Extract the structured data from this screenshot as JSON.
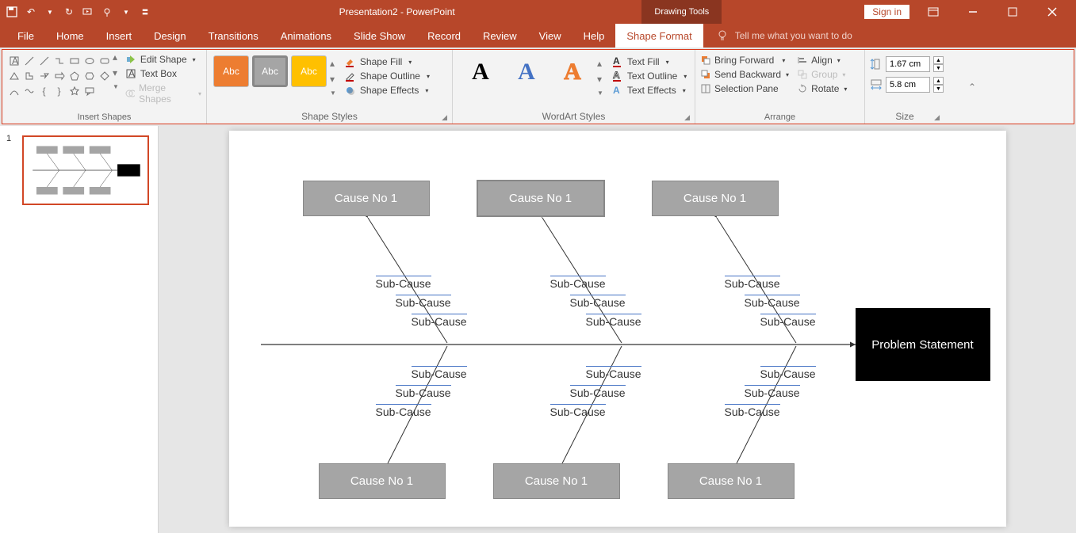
{
  "title": "Presentation2 - PowerPoint",
  "contextual_tab": "Drawing Tools",
  "signin": "Sign in",
  "menu": {
    "file": "File",
    "home": "Home",
    "insert": "Insert",
    "design": "Design",
    "transitions": "Transitions",
    "animations": "Animations",
    "slideshow": "Slide Show",
    "record": "Record",
    "review": "Review",
    "view": "View",
    "help": "Help",
    "shapeformat": "Shape Format",
    "tellme": "Tell me what you want to do"
  },
  "ribbon": {
    "insert_shapes": {
      "label": "Insert Shapes",
      "edit_shape": "Edit Shape",
      "text_box": "Text Box",
      "merge_shapes": "Merge Shapes"
    },
    "shape_styles": {
      "label": "Shape Styles",
      "swatch": "Abc",
      "fill": "Shape Fill",
      "outline": "Shape Outline",
      "effects": "Shape Effects"
    },
    "wordart": {
      "label": "WordArt Styles",
      "text_fill": "Text Fill",
      "text_outline": "Text Outline",
      "text_effects": "Text Effects"
    },
    "arrange": {
      "label": "Arrange",
      "bring_forward": "Bring Forward",
      "send_backward": "Send Backward",
      "selection_pane": "Selection Pane",
      "align": "Align",
      "group": "Group",
      "rotate": "Rotate"
    },
    "size": {
      "label": "Size",
      "height": "1.67 cm",
      "width": "5.8 cm"
    }
  },
  "slide_number": "1",
  "diagram": {
    "cause_top": "Cause No 1",
    "cause_bottom": "Cause No 1",
    "sub": "Sub-Cause",
    "problem": "Problem Statement"
  }
}
